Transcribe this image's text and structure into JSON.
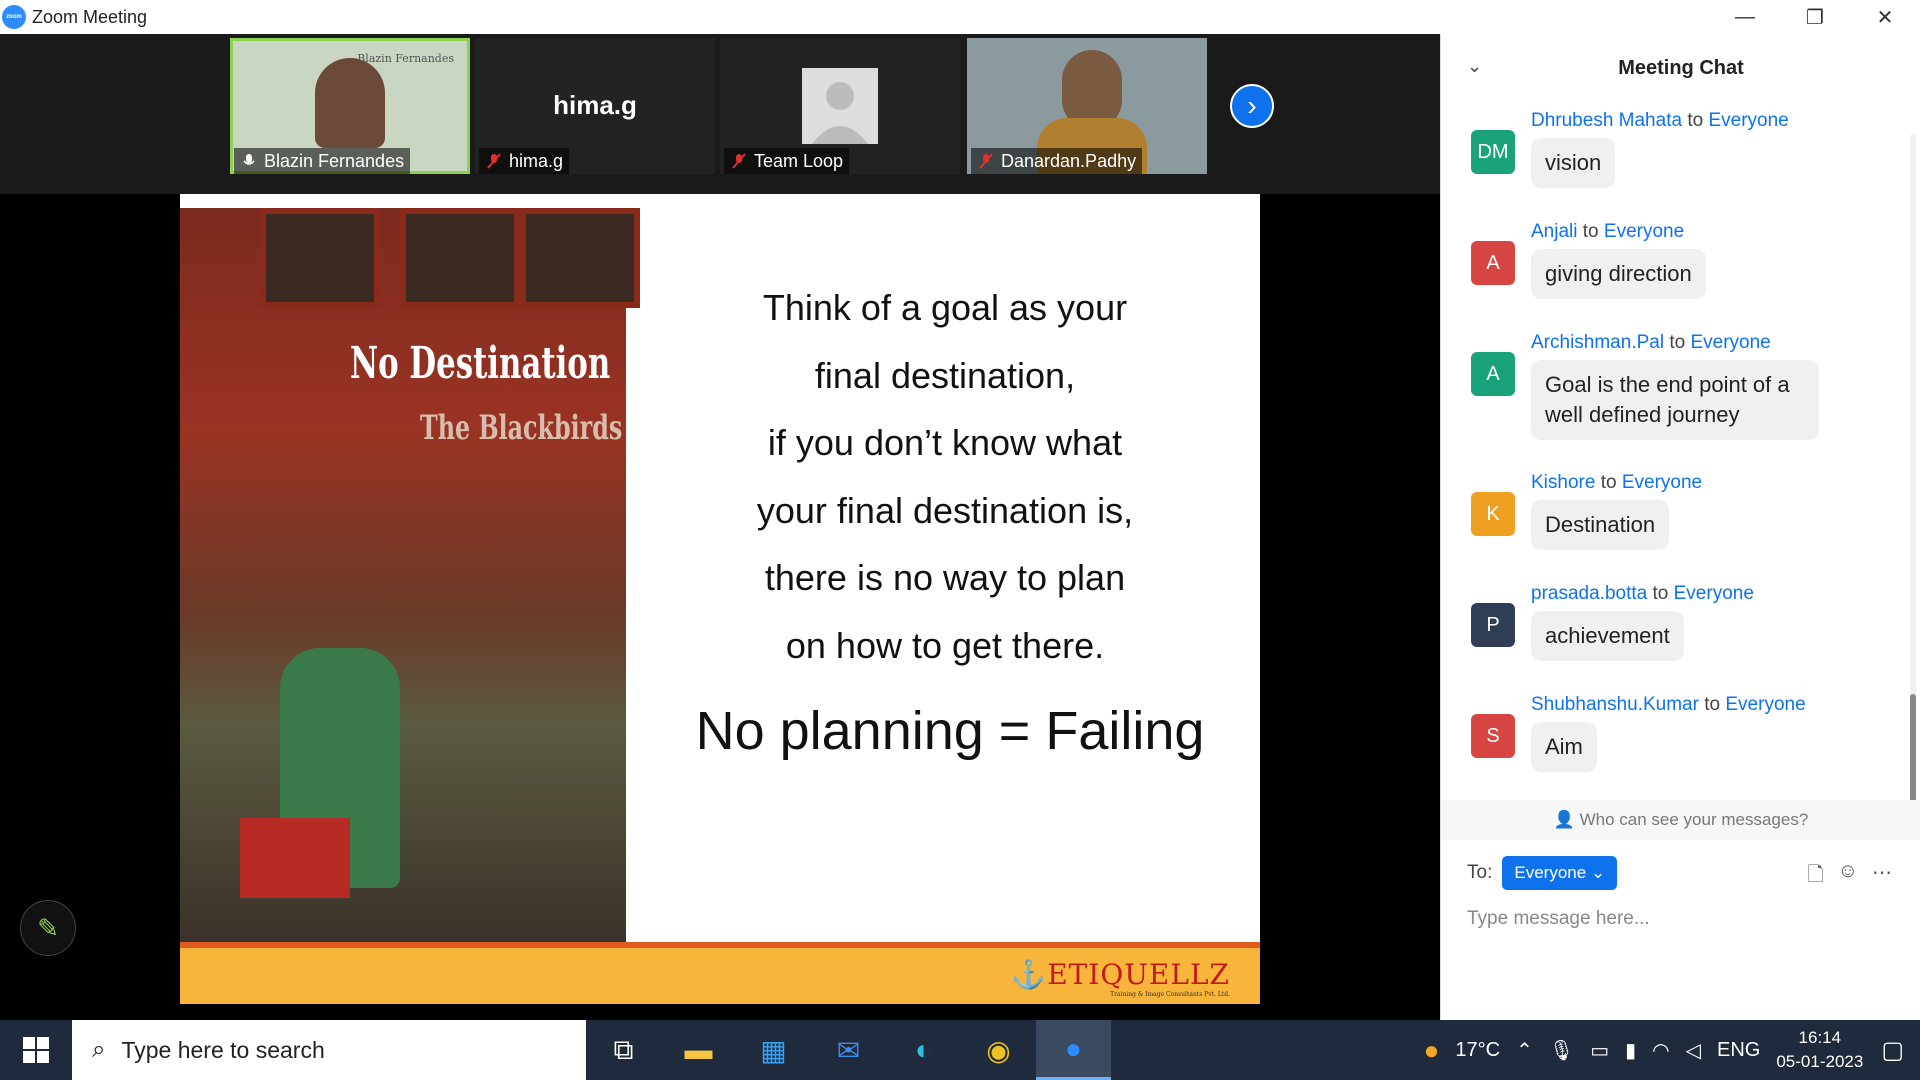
{
  "window": {
    "title": "Zoom Meeting",
    "minimize": "—",
    "restore": "❐",
    "close": "✕"
  },
  "participants": [
    {
      "name": "Blazin Fernandes",
      "watermark": "Blazin Fernandes"
    },
    {
      "name": "hima.g",
      "bigname": "hima.g"
    },
    {
      "name": "Team Loop"
    },
    {
      "name": "Danardan.Padhy"
    }
  ],
  "slide": {
    "lines": [
      "Think of a goal as your",
      "final destination,",
      "if you don’t know what",
      "your final destination is,",
      "there is no way to plan",
      "on how to get there."
    ],
    "emphasis": "No planning = Failing",
    "photo_sign": "No Destination",
    "photo_sign2": "The Blackbirds",
    "brand": "ETIQUELLZ",
    "brand_sub": "Training & Image Consultants Pvt. Ltd."
  },
  "chat": {
    "title": "Meeting Chat",
    "to_word": "to",
    "messages": [
      {
        "sender": "Dhrubesh Mahata",
        "recipient": "Everyone",
        "initials": "DM",
        "color": "#1aa37a",
        "text": "vision"
      },
      {
        "sender": "Anjali",
        "recipient": "Everyone",
        "initials": "A",
        "color": "#d64541",
        "text": "giving direction"
      },
      {
        "sender": "Archishman.Pal",
        "recipient": "Everyone",
        "initials": "A",
        "color": "#1aa37a",
        "text": "Goal is the end point of a well defined journey"
      },
      {
        "sender": "Kishore",
        "recipient": "Everyone",
        "initials": "K",
        "color": "#f0a020",
        "text": "Destination"
      },
      {
        "sender": "prasada.botta",
        "recipient": "Everyone",
        "initials": "P",
        "color": "#2f3e55",
        "text": "achievement"
      },
      {
        "sender": "Shubhanshu.Kumar",
        "recipient": "Everyone",
        "initials": "S",
        "color": "#d64541",
        "text": "Aim"
      }
    ],
    "who_can_see": "Who can see your messages?",
    "to_label": "To:",
    "recipient_button": "Everyone ⌄",
    "placeholder": "Type message here..."
  },
  "taskbar": {
    "search_placeholder": "Type here to search",
    "weather": "17°C",
    "language": "ENG",
    "time": "16:14",
    "date": "05-01-2023"
  }
}
